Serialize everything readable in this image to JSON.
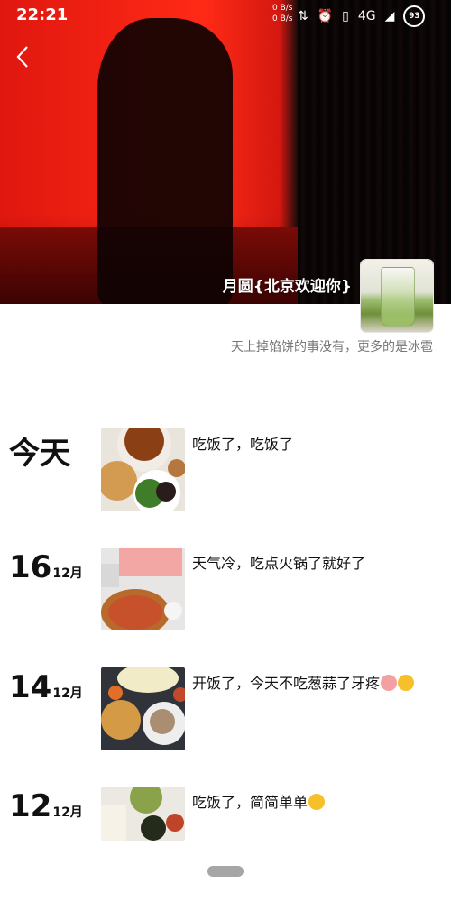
{
  "status_bar": {
    "time": "22:21",
    "net_up": "0 B/s",
    "net_down": "0 B/s",
    "network": "4G",
    "battery": "93",
    "icons": [
      "data-transfer-icon",
      "alarm-icon",
      "vibrate-icon",
      "signal-icon",
      "battery-icon"
    ]
  },
  "profile": {
    "nickname": "月圆{北京欢迎你}",
    "signature": "天上掉馅饼的事没有，更多的是冰雹"
  },
  "feed": [
    {
      "date_day": "今天",
      "date_month": "",
      "caption": "吃饭了，吃饭了"
    },
    {
      "date_day": "16",
      "date_month": "12月",
      "caption": "天气冷，吃点火锅了就好了"
    },
    {
      "date_day": "14",
      "date_month": "12月",
      "caption": "开饭了，今天不吃葱蒜了牙疼"
    },
    {
      "date_day": "12",
      "date_month": "12月",
      "caption": "吃饭了，简简单单"
    }
  ]
}
